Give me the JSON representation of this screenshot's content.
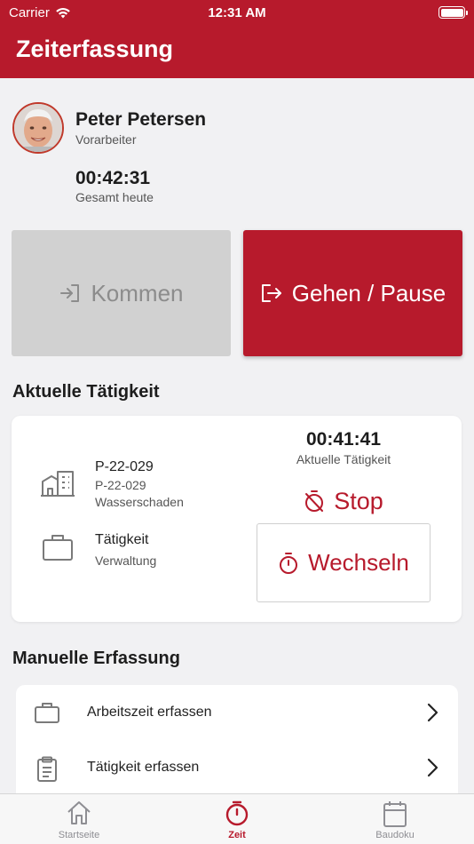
{
  "status_bar": {
    "carrier": "Carrier",
    "time": "12:31 AM"
  },
  "nav": {
    "title": "Zeiterfassung"
  },
  "profile": {
    "name": "Peter Petersen",
    "role": "Vorarbeiter",
    "total_time": "00:42:31",
    "total_label": "Gesamt heute"
  },
  "actions": {
    "kommen": "Kommen",
    "gehen_pause": "Gehen / Pause"
  },
  "current_activity": {
    "section_title": "Aktuelle Tätigkeit",
    "project_code": "P-22-029",
    "project_sub": "P-22-029",
    "project_desc": "Wasserschaden",
    "activity_title": "Tätigkeit",
    "activity_value": "Verwaltung",
    "timer": "00:41:41",
    "timer_label": "Aktuelle Tätigkeit",
    "stop_label": "Stop",
    "switch_label": "Wechseln"
  },
  "manual": {
    "section_title": "Manuelle Erfassung",
    "items": [
      {
        "label": "Arbeitszeit erfassen",
        "icon": "briefcase-icon"
      },
      {
        "label": "Tätigkeit erfassen",
        "icon": "clipboard-icon"
      }
    ]
  },
  "tabs": [
    {
      "label": "Startseite",
      "icon": "home-icon",
      "active": false
    },
    {
      "label": "Zeit",
      "icon": "stopwatch-icon",
      "active": true
    },
    {
      "label": "Baudoku",
      "icon": "calendar-icon",
      "active": false
    }
  ],
  "colors": {
    "brand": "#b71a2c",
    "disabled": "#d1d1d1",
    "background": "#f1f1f3"
  }
}
